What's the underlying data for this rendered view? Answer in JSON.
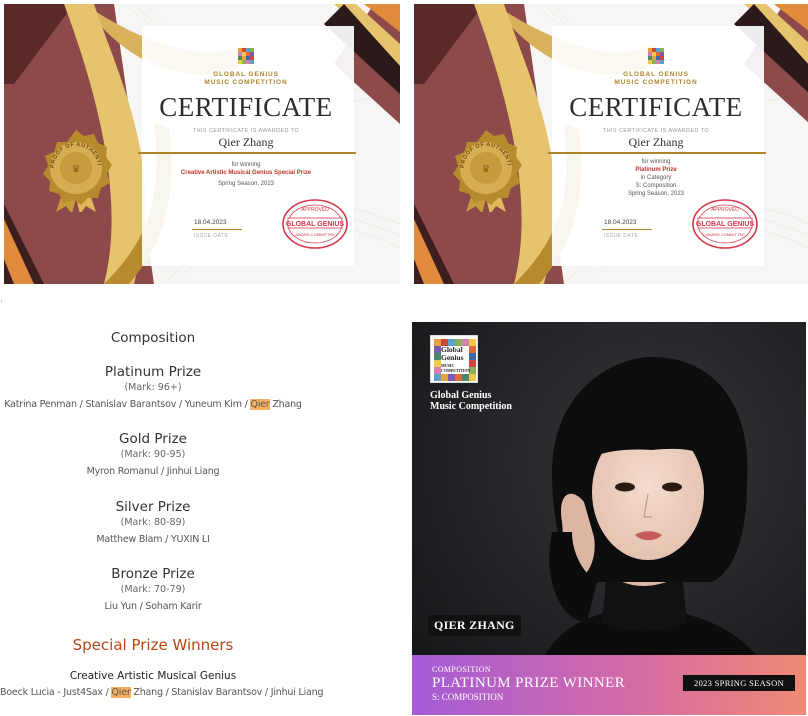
{
  "certificate_1": {
    "org_line1": "GLOBAL GENIUS",
    "org_line2": "MUSIC COMPETITION",
    "title": "CERTIFICATE",
    "awarded_to": "THIS CERTIFICATE IS AWARDED TO",
    "recipient": "Qier Zhang",
    "for_winning": "for winning",
    "prize": "Creative Artistic Musical Genius Special Prize",
    "season": "Spring Season, 2023",
    "date": "18.04.2023",
    "issue_date_label": "ISSUE DATE",
    "seal_text": "PROOF OF AUTHENTICITY",
    "stamp_top": "APPROVED",
    "stamp_main": "GLOBAL GENIUS",
    "stamp_bottom": "AWARD COMMITTEE"
  },
  "certificate_2": {
    "org_line1": "GLOBAL GENIUS",
    "org_line2": "MUSIC COMPETITION",
    "title": "CERTIFICATE",
    "awarded_to": "THIS CERTIFICATE IS AWARDED TO",
    "recipient": "Qier Zhang",
    "for_winning": "for winning",
    "prize": "Platinum Prize",
    "in_category": "in Category",
    "category": "S: Composition",
    "season": "Spring Season, 2023",
    "date": "18.04.2023",
    "issue_date_label": "ISSUE DATE",
    "seal_text": "PROOF OF AUTHENTICITY",
    "stamp_top": "APPROVED",
    "stamp_main": "GLOBAL GENIUS",
    "stamp_bottom": "AWARD COMMITTEE"
  },
  "results": {
    "side_mark": "↑",
    "section_title": "Composition",
    "platinum": {
      "title": "Platinum Prize",
      "mark": "(Mark: 96+)",
      "names_before": "Katrina Penman / Stanislav Barantsov / Yuneum Kim / ",
      "highlight": "Qier",
      "names_after": " Zhang"
    },
    "gold": {
      "title": "Gold Prize",
      "mark": "(Mark: 90-95)",
      "names": "Myron Romanul / Jinhui Liang"
    },
    "silver": {
      "title": "Silver Prize",
      "mark": "(Mark: 80-89)",
      "names": "Matthew Blam / YUXIN LI"
    },
    "bronze": {
      "title": "Bronze Prize",
      "mark": "(Mark: 70-79)",
      "names": "Liu Yun / Soham Karir"
    },
    "special_title": "Special Prize Winners",
    "special_category": "Creative Artistic Musical Genius",
    "special": {
      "names_before": "Boeck Lucia - Just4Sax / ",
      "highlight": "Qier",
      "names_after": " Zhang / Stanislav Barantsov / Jinhui Liang"
    }
  },
  "winner_card": {
    "logo_line1": "Global",
    "logo_line2": "Genius",
    "logo_line3": "MUSIC",
    "logo_line4": "COMPETITION",
    "org_line1": "Global Genius",
    "org_line2": "Music Competition",
    "name_tag": "QIER ZHANG",
    "category_small": "COMPOSITION",
    "award": "PLATINUM PRIZE WINNER",
    "category": "S: COMPOSITION",
    "season": "2023 SPRING SEASON"
  },
  "colors": {
    "gold": "#b0852a",
    "maroon": "#8c4a4a",
    "highlight": "#f7b15d",
    "special_prize": "#b74614"
  }
}
